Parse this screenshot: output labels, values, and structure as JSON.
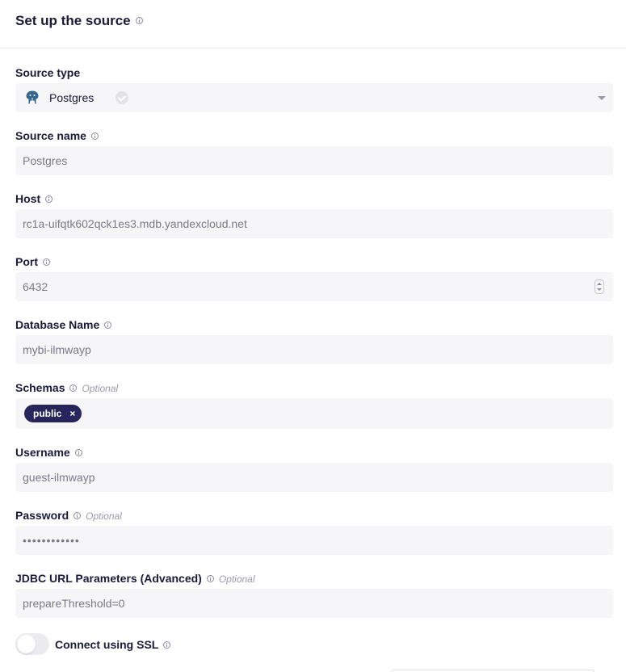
{
  "header": {
    "title": "Set up the source",
    "info_icon": "info-icon"
  },
  "fields": {
    "source_type": {
      "label": "Source type",
      "value": "Postgres",
      "icon": "postgres-elephant-icon"
    },
    "source_name": {
      "label": "Source name",
      "value": "Postgres"
    },
    "host": {
      "label": "Host",
      "value": "rc1a-uifqtk602qck1es3.mdb.yandexcloud.net"
    },
    "port": {
      "label": "Port",
      "value": "6432"
    },
    "database_name": {
      "label": "Database Name",
      "value": "mybi-ilmwayp"
    },
    "schemas": {
      "label": "Schemas",
      "optional": "Optional",
      "chips": [
        "public"
      ],
      "chip_remove": "×"
    },
    "username": {
      "label": "Username",
      "value": "guest-ilmwayp"
    },
    "password": {
      "label": "Password",
      "optional": "Optional",
      "value": "••••••••••••"
    },
    "jdbc": {
      "label": "JDBC URL Parameters (Advanced)",
      "optional": "Optional",
      "value": "prepareThreshold=0"
    },
    "ssl": {
      "label": "Connect using SSL",
      "enabled": false
    }
  },
  "colors": {
    "chip_bg": "#26265a",
    "field_bg": "#f6f6f8",
    "text_primary": "#1a1a3a",
    "text_muted": "#7a7a88"
  }
}
